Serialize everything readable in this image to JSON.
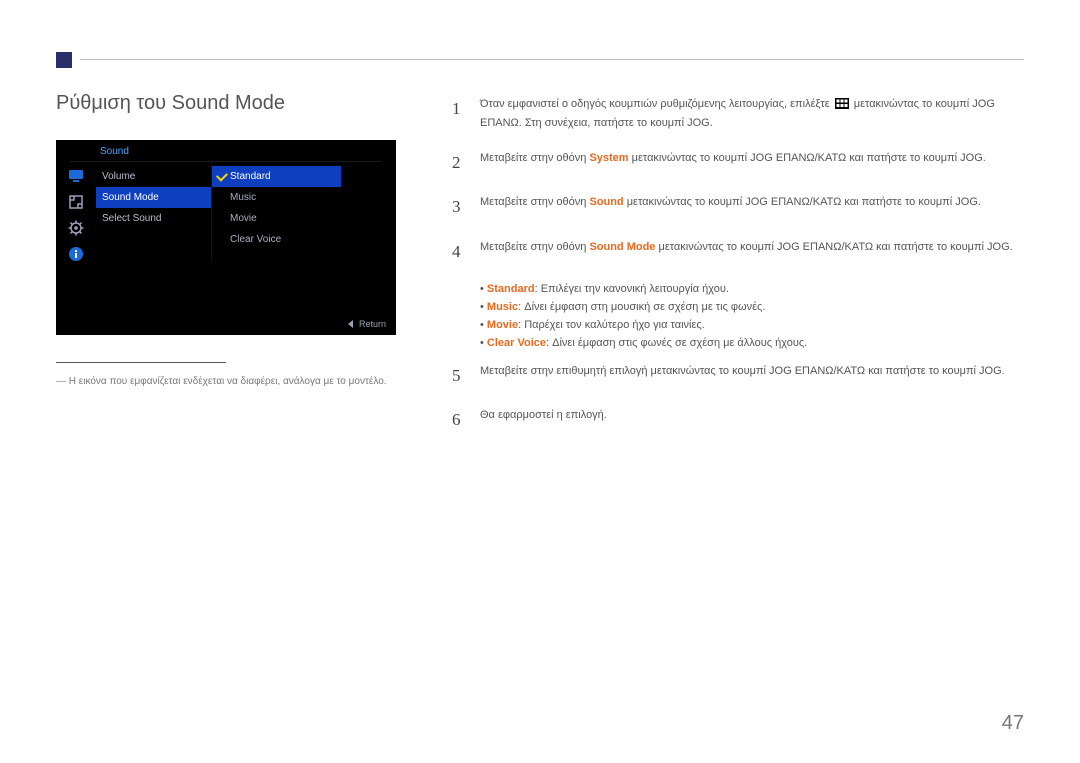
{
  "title": "Ρύθμιση του Sound Mode",
  "osd": {
    "header": "Sound",
    "left": [
      "Volume",
      "Sound Mode",
      "Select Sound"
    ],
    "left_selected_index": 1,
    "right": [
      "Standard",
      "Music",
      "Movie",
      "Clear Voice"
    ],
    "right_selected_index": 0,
    "return_label": "Return"
  },
  "note": "Η εικόνα που εμφανίζεται ενδέχεται να διαφέρει, ανάλογα με το μοντέλο.",
  "steps": {
    "s1a": "Όταν εμφανιστεί ο οδηγός κουμπιών ρυθμιζόμενης λειτουργίας, επιλέξτε ",
    "s1b": " μετακινώντας το κουμπί JOG ΕΠΑΝΩ. Στη συνέχεια, πατήστε το κουμπί JOG.",
    "s2a": "Μεταβείτε στην οθόνη ",
    "s2_system": "System",
    "s2b": " μετακινώντας το κουμπί JOG ΕΠΑΝΩ/ΚΑΤΩ και πατήστε το κουμπί JOG.",
    "s3a": "Μεταβείτε στην οθόνη ",
    "s3_sound": "Sound",
    "s3b": " μετακινώντας το κουμπί JOG ΕΠΑΝΩ/ΚΑΤΩ και πατήστε το κουμπί JOG.",
    "s4a": "Μεταβείτε στην οθόνη ",
    "s4_sm": "Sound Mode",
    "s4b": " μετακινώντας το κουμπί JOG ΕΠΑΝΩ/ΚΑΤΩ και πατήστε το κουμπί JOG.",
    "s5": "Μεταβείτε στην επιθυμητή επιλογή μετακινώντας το κουμπί JOG ΕΠΑΝΩ/ΚΑΤΩ και πατήστε το κουμπί JOG.",
    "s6": "Θα εφαρμοστεί η επιλογή."
  },
  "bullets": {
    "b1_label": "Standard",
    "b1_text": ": Επιλέγει την κανονική λειτουργία ήχου.",
    "b2_label": "Music",
    "b2_text": ": Δίνει έμφαση στη μουσική σε σχέση με τις φωνές.",
    "b3_label": "Movie",
    "b3_text": ": Παρέχει τον καλύτερο ήχο για ταινίες.",
    "b4_label": "Clear Voice",
    "b4_text": ": Δίνει έμφαση στις φωνές σε σχέση με άλλους ήχους."
  },
  "page_number": "47"
}
